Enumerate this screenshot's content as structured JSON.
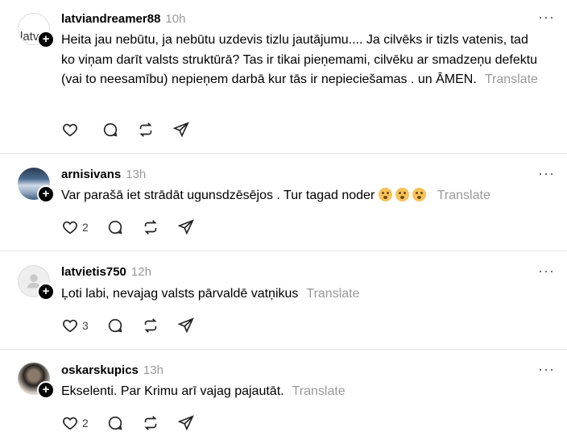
{
  "colors": {
    "muted": "#999999",
    "text": "#000000",
    "divider": "#e6e6e6"
  },
  "posts": [
    {
      "username": "latviandreamer88",
      "time": "10h",
      "avatar_alt": "latv",
      "text": "Heita jau nebūtu, ja nebūtu uzdevis tizlu jautājumu.... Ja cilvēks ir tizls vatenis, tad ko viņam darīt valsts struktūrā? Tas ir tikai pieņemami, cilvēku ar smadzeņu defektu (vai to neesamību) nepieņem darbā kur tās ir nepieciešamas . un ĀMEN.",
      "translate": "Translate",
      "likes": ""
    },
    {
      "username": "arnisivans",
      "time": "13h",
      "text": "Var parašā iet strādāt ugunsdzēsējos . Tur tagad noder",
      "emoji_count": 3,
      "translate": "Translate",
      "likes": "2"
    },
    {
      "username": "latvietis750",
      "time": "12h",
      "text": "Ļoti labi, nevajag valsts pārvaldē vatņikus",
      "translate": "Translate",
      "likes": "3"
    },
    {
      "username": "oskarskupics",
      "time": "13h",
      "text": "Ekselenti. Par Krimu arī vajag pajautāt.",
      "translate": "Translate",
      "likes": "2"
    }
  ],
  "icons": {
    "like": "heart-icon",
    "reply": "comment-icon",
    "repost": "repost-icon",
    "share": "send-icon",
    "more": "more-icon",
    "follow": "plus-icon"
  }
}
